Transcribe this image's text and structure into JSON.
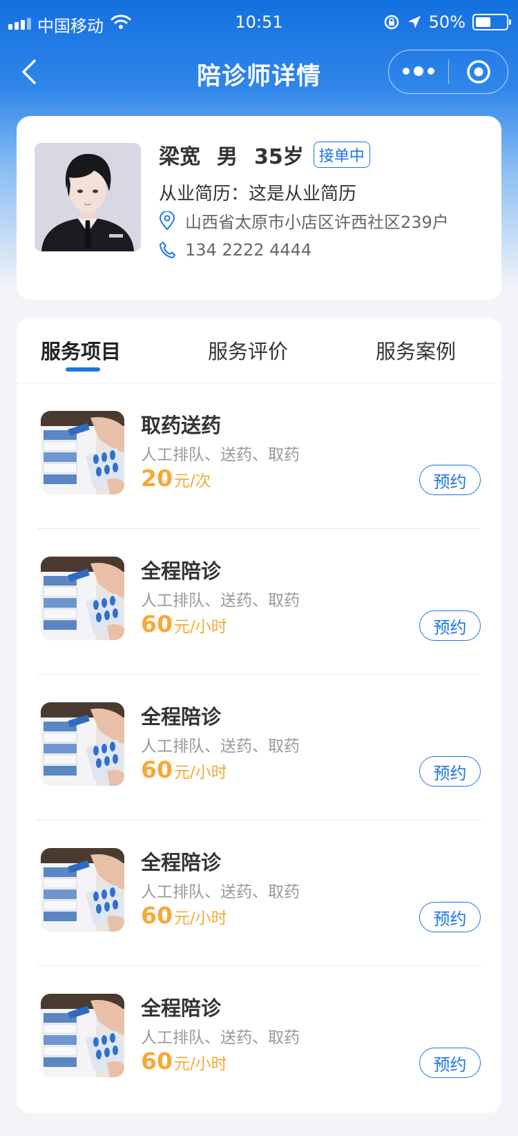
{
  "status_bar": {
    "carrier": "中国移动",
    "time": "10:51",
    "battery_text": "50%",
    "battery_level": 0.5
  },
  "nav": {
    "title": "陪诊师详情"
  },
  "profile": {
    "name": "梁宽",
    "gender": "男",
    "age": "35岁",
    "status_badge": "接单中",
    "resume": "从业简历：这是从业简历",
    "address": "山西省太原市小店区许西社区239户",
    "phone": "134 2222 4444"
  },
  "tabs": [
    {
      "label": "服务项目",
      "active": true
    },
    {
      "label": "服务评价",
      "active": false
    },
    {
      "label": "服务案例",
      "active": false
    }
  ],
  "services": [
    {
      "name": "取药送药",
      "desc": "人工排队、送药、取药",
      "price": "20",
      "unit": "元/次",
      "button": "预约"
    },
    {
      "name": "全程陪诊",
      "desc": "人工排队、送药、取药",
      "price": "60",
      "unit": "元/小时",
      "button": "预约"
    },
    {
      "name": "全程陪诊",
      "desc": "人工排队、送药、取药",
      "price": "60",
      "unit": "元/小时",
      "button": "预约"
    },
    {
      "name": "全程陪诊",
      "desc": "人工排队、送药、取药",
      "price": "60",
      "unit": "元/小时",
      "button": "预约"
    },
    {
      "name": "全程陪诊",
      "desc": "人工排队、送药、取药",
      "price": "60",
      "unit": "元/小时",
      "button": "预约"
    }
  ],
  "colors": {
    "brand_blue": "#1a74e6",
    "price_orange": "#f6a935"
  }
}
